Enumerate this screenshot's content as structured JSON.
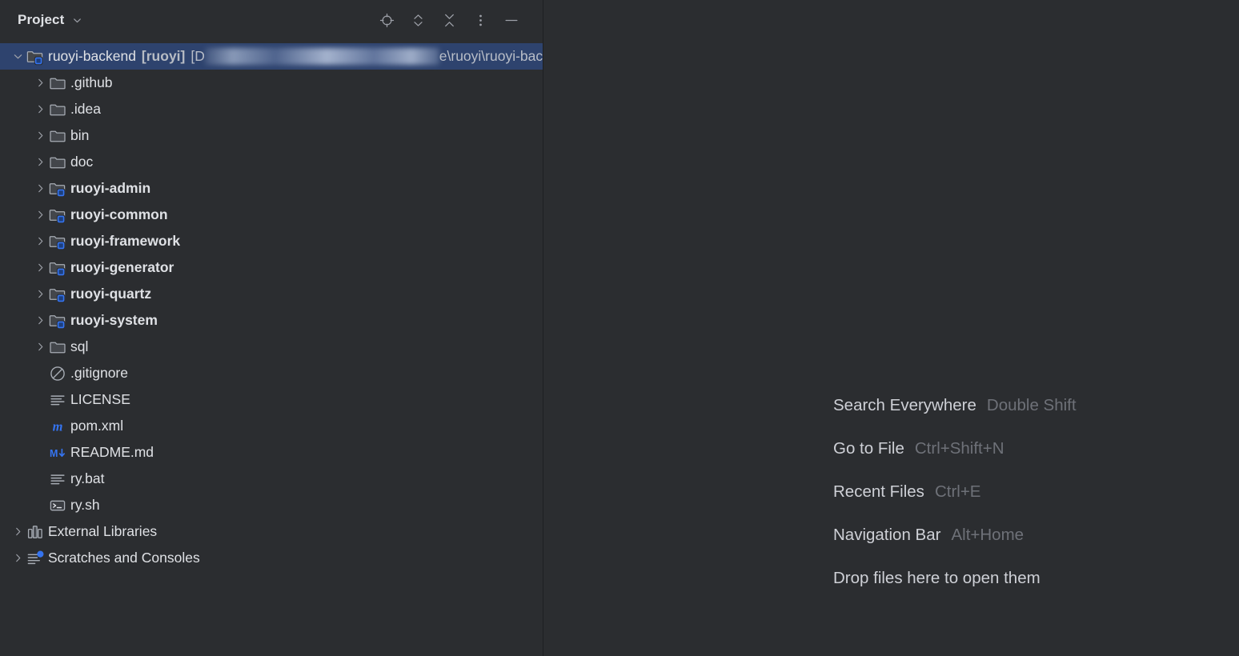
{
  "window": {
    "background": "#2b2d30",
    "selection_color": "#2e436e",
    "accent_color": "#3574f0"
  },
  "project_panel": {
    "header": {
      "title": "Project",
      "title_chevron_icon": "chevron-down-icon",
      "actions": [
        {
          "name": "select-opened-file-icon",
          "label": "Select Opened File"
        },
        {
          "name": "expand-collapse-icon",
          "label": "Expand / Collapse"
        },
        {
          "name": "collapse-all-icon",
          "label": "Collapse All"
        },
        {
          "name": "more-options-icon",
          "label": "More Options"
        },
        {
          "name": "hide-tool-window-icon",
          "label": "Hide"
        }
      ]
    },
    "tree": [
      {
        "label": "ruoyi-backend",
        "suffix": "[ruoyi]",
        "path_prefix": "D",
        "path_redacted": true,
        "path_suffix": "e\\ruoyi\\ruoyi-backend",
        "icon": "module-folder-icon",
        "twisty": "expanded",
        "indent": 0,
        "selected": true,
        "bold": false
      },
      {
        "label": ".github",
        "icon": "folder-icon",
        "twisty": "collapsed",
        "indent": 1,
        "bold": false
      },
      {
        "label": ".idea",
        "icon": "folder-icon",
        "twisty": "collapsed",
        "indent": 1,
        "bold": false
      },
      {
        "label": "bin",
        "icon": "folder-icon",
        "twisty": "collapsed",
        "indent": 1,
        "bold": false
      },
      {
        "label": "doc",
        "icon": "folder-icon",
        "twisty": "collapsed",
        "indent": 1,
        "bold": false
      },
      {
        "label": "ruoyi-admin",
        "icon": "module-folder-icon",
        "twisty": "collapsed",
        "indent": 1,
        "bold": true
      },
      {
        "label": "ruoyi-common",
        "icon": "module-folder-icon",
        "twisty": "collapsed",
        "indent": 1,
        "bold": true
      },
      {
        "label": "ruoyi-framework",
        "icon": "module-folder-icon",
        "twisty": "collapsed",
        "indent": 1,
        "bold": true
      },
      {
        "label": "ruoyi-generator",
        "icon": "module-folder-icon",
        "twisty": "collapsed",
        "indent": 1,
        "bold": true
      },
      {
        "label": "ruoyi-quartz",
        "icon": "module-folder-icon",
        "twisty": "collapsed",
        "indent": 1,
        "bold": true
      },
      {
        "label": "ruoyi-system",
        "icon": "module-folder-icon",
        "twisty": "collapsed",
        "indent": 1,
        "bold": true
      },
      {
        "label": "sql",
        "icon": "folder-icon",
        "twisty": "collapsed",
        "indent": 1,
        "bold": false
      },
      {
        "label": ".gitignore",
        "icon": "gitignore-icon",
        "twisty": "none",
        "indent": 1,
        "bold": false
      },
      {
        "label": "LICENSE",
        "icon": "text-file-icon",
        "twisty": "none",
        "indent": 1,
        "bold": false
      },
      {
        "label": "pom.xml",
        "icon": "maven-icon",
        "twisty": "none",
        "indent": 1,
        "bold": false
      },
      {
        "label": "README.md",
        "icon": "markdown-icon",
        "twisty": "none",
        "indent": 1,
        "bold": false
      },
      {
        "label": "ry.bat",
        "icon": "text-file-icon",
        "twisty": "none",
        "indent": 1,
        "bold": false
      },
      {
        "label": "ry.sh",
        "icon": "shell-script-icon",
        "twisty": "none",
        "indent": 1,
        "bold": false
      },
      {
        "label": "External Libraries",
        "icon": "libraries-icon",
        "twisty": "collapsed",
        "indent": 0,
        "bold": false
      },
      {
        "label": "Scratches and Consoles",
        "icon": "scratches-icon",
        "twisty": "collapsed",
        "indent": 0,
        "bold": false
      }
    ]
  },
  "editor": {
    "empty_state_hints": [
      {
        "action": "Search Everywhere",
        "shortcut": "Double Shift"
      },
      {
        "action": "Go to File",
        "shortcut": "Ctrl+Shift+N"
      },
      {
        "action": "Recent Files",
        "shortcut": "Ctrl+E"
      },
      {
        "action": "Navigation Bar",
        "shortcut": "Alt+Home"
      },
      {
        "action": "Drop files here to open them",
        "shortcut": ""
      }
    ]
  }
}
